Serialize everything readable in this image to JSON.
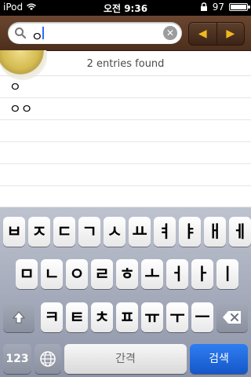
{
  "status_bar": {
    "carrier": "iPod",
    "time": "오전 9:36",
    "battery": "97"
  },
  "search": {
    "value": "ㅇ",
    "clear_icon": "clear-icon"
  },
  "nav": {
    "prev_icon": "left-arrow-icon",
    "next_icon": "right-arrow-icon"
  },
  "results": {
    "count_text": "2 entries found",
    "items": [
      "ㅇ",
      "ㅇㅇ"
    ]
  },
  "keyboard": {
    "row1": [
      "ㅂ",
      "ㅈ",
      "ㄷ",
      "ㄱ",
      "ㅅ",
      "ㅛ",
      "ㅕ",
      "ㅑ",
      "ㅐ",
      "ㅔ"
    ],
    "row2": [
      "ㅁ",
      "ㄴ",
      "ㅇ",
      "ㄹ",
      "ㅎ",
      "ㅗ",
      "ㅓ",
      "ㅏ",
      "ㅣ"
    ],
    "row3": [
      "ㅋ",
      "ㅌ",
      "ㅊ",
      "ㅍ",
      "ㅠ",
      "ㅜ",
      "ㅡ"
    ],
    "shift_icon": "shift-icon",
    "delete_icon": "delete-icon",
    "numbers_label": "123",
    "globe_icon": "globe-icon",
    "space_label": "간격",
    "search_label": "검색"
  },
  "colors": {
    "status_bar": "#000000",
    "topbar": "#5a3a27",
    "accent_arrow": "#f0b820",
    "keyboard_bg": "#a0a6b4",
    "search_key": "#1f66df"
  }
}
